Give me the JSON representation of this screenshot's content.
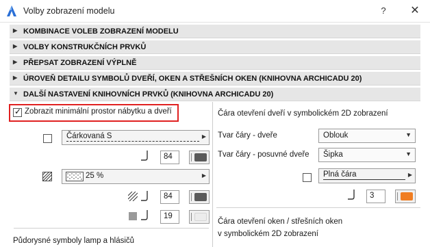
{
  "window": {
    "title": "Volby zobrazení modelu",
    "help_label": "?",
    "close_label": "✕"
  },
  "panels": [
    {
      "label": "KOMBINACE VOLEB ZOBRAZENÍ MODELU",
      "expanded": false
    },
    {
      "label": "VOLBY KONSTRUKČNÍCH PRVKŮ",
      "expanded": false
    },
    {
      "label": "PŘEPSAT ZOBRAZENÍ VÝPLNĚ",
      "expanded": false
    },
    {
      "label": "ÚROVEŇ DETAILU SYMBOLŮ DVEŘÍ, OKEN A STŘEŠNÍCH OKEN (KNIHOVNA ARCHICADU 20)",
      "expanded": false
    },
    {
      "label": "DALŠÍ NASTAVENÍ KNIHOVNÍCH PRVKŮ (KNIHOVNA ARCHICADU 20)",
      "expanded": true
    }
  ],
  "left": {
    "furniture_checkbox_label": "Zobrazit minimální prostor nábytku a dveří",
    "furniture_checked": true,
    "line_type_value": "Čárkovaná S",
    "line_type_checked": false,
    "line_pen_value": "84",
    "fill_value": "25 %",
    "fill_pen_value": "84",
    "bg_pen_value": "19",
    "footer_label": "Půdorysné symboly lamp a hlásičů"
  },
  "right": {
    "door_heading": "Čára otevření dveří v symbolickém 2D zobrazení",
    "door_shape_label": "Tvar čáry - dveře",
    "door_shape_value": "Oblouk",
    "sliding_shape_label": "Tvar čáry - posuvné dveře",
    "sliding_shape_value": "Šipka",
    "line_type_value": "Plná čára",
    "line_type_checked": false,
    "pen_value": "3",
    "window_heading_1": "Čára otevření oken / střešních oken",
    "window_heading_2": "v symbolickém 2D zobrazení"
  },
  "colors": {
    "highlight": "#e02020",
    "pen_dark": "#5a5a5a",
    "pen_light": "#ececec",
    "pen_orange": "#f07d22",
    "accent_logo": "#2a6fd6"
  }
}
